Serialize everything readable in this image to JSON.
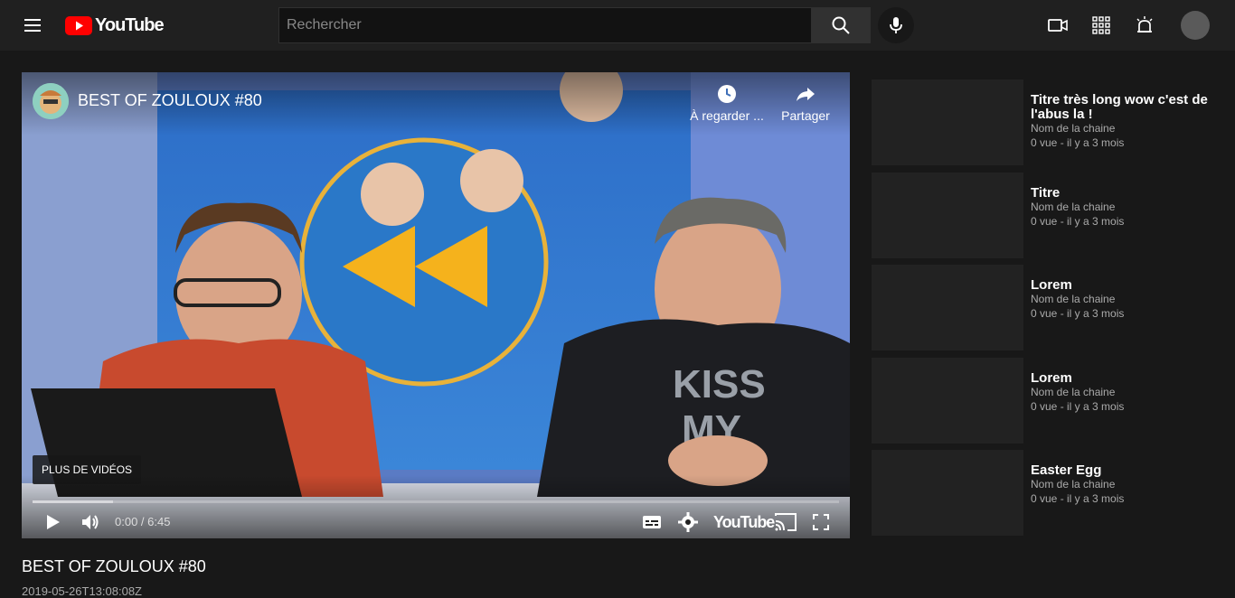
{
  "header": {
    "logo_text": "YouTube",
    "search_placeholder": "Rechercher",
    "search_value": ""
  },
  "player": {
    "title": "BEST OF ZOULOUX #80",
    "watch_later_label": "À regarder ...",
    "share_label": "Partager",
    "more_videos_label": "PLUS DE VIDÉOS",
    "time_display": "0:00 / 6:45",
    "logo_text": "YouTube",
    "buffered_fraction": 0.1
  },
  "video": {
    "title": "BEST OF ZOULOUX #80",
    "date": "2019-05-26T13:08:08Z"
  },
  "sidebar": {
    "items": [
      {
        "title": "Titre très long wow c'est de l'abus la !",
        "channel": "Nom de la chaine",
        "meta": "0 vue - il y a 3 mois"
      },
      {
        "title": "Titre",
        "channel": "Nom de la chaine",
        "meta": "0 vue - il y a 3 mois"
      },
      {
        "title": "Lorem",
        "channel": "Nom de la chaine",
        "meta": "0 vue - il y a 3 mois"
      },
      {
        "title": "Lorem",
        "channel": "Nom de la chaine",
        "meta": "0 vue - il y a 3 mois"
      },
      {
        "title": "Easter Egg",
        "channel": "Nom de la chaine",
        "meta": "0 vue - il y a 3 mois"
      }
    ]
  },
  "colors": {
    "background": "#181818",
    "header": "#202020",
    "brand_red": "#ff0000",
    "secondary_text": "#aaaaaa"
  },
  "icons": [
    "menu-icon",
    "youtube-logo-icon",
    "search-icon",
    "mic-icon",
    "create-video-icon",
    "apps-grid-icon",
    "notifications-icon",
    "clock-icon",
    "share-icon",
    "play-icon",
    "volume-icon",
    "subtitles-icon",
    "settings-icon",
    "cast-icon",
    "fullscreen-icon"
  ]
}
